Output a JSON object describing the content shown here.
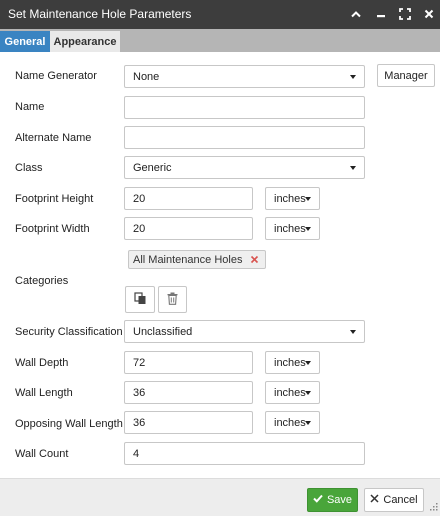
{
  "window": {
    "title": "Set Maintenance Hole Parameters"
  },
  "tabs": [
    {
      "label": "General",
      "active": true
    },
    {
      "label": "Appearance",
      "active": false
    }
  ],
  "form": {
    "name_generator": {
      "label": "Name Generator",
      "value": "None",
      "manager_label": "Manager"
    },
    "name": {
      "label": "Name",
      "value": ""
    },
    "alternate_name": {
      "label": "Alternate Name",
      "value": ""
    },
    "class": {
      "label": "Class",
      "value": "Generic"
    },
    "footprint_height": {
      "label": "Footprint Height",
      "value": "20",
      "unit": "inches"
    },
    "footprint_width": {
      "label": "Footprint Width",
      "value": "20",
      "unit": "inches"
    },
    "categories": {
      "label": "Categories",
      "chips": [
        "All Maintenance Holes"
      ]
    },
    "security_classification": {
      "label": "Security Classification",
      "value": "Unclassified"
    },
    "wall_depth": {
      "label": "Wall Depth",
      "value": "72",
      "unit": "inches"
    },
    "wall_length": {
      "label": "Wall Length",
      "value": "36",
      "unit": "inches"
    },
    "opposing_wall_length": {
      "label": "Opposing Wall Length",
      "value": "36",
      "unit": "inches"
    },
    "wall_count": {
      "label": "Wall Count",
      "value": "4"
    }
  },
  "footer": {
    "save_label": "Save",
    "cancel_label": "Cancel"
  },
  "colors": {
    "titlebar": "#3d3d3d",
    "active_tab": "#3a84c2",
    "tabbar": "#b5b5b5",
    "save": "#49a53a",
    "remove_x": "#d9534f"
  }
}
